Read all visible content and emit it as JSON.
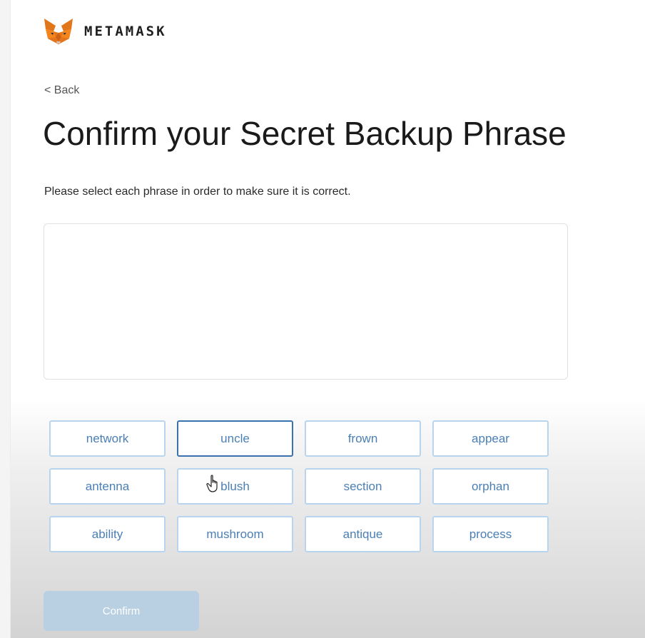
{
  "header": {
    "brand": "METAMASK",
    "logo_icon": "metamask-fox-icon"
  },
  "back": {
    "label": "< Back"
  },
  "title": "Confirm your Secret Backup Phrase",
  "instructions": "Please select each phrase in order to make sure it is correct.",
  "words": [
    {
      "label": "network",
      "selected": false
    },
    {
      "label": "uncle",
      "selected": true
    },
    {
      "label": "frown",
      "selected": false
    },
    {
      "label": "appear",
      "selected": false
    },
    {
      "label": "antenna",
      "selected": false
    },
    {
      "label": "blush",
      "selected": false
    },
    {
      "label": "section",
      "selected": false
    },
    {
      "label": "orphan",
      "selected": false
    },
    {
      "label": "ability",
      "selected": false
    },
    {
      "label": "mushroom",
      "selected": false
    },
    {
      "label": "antique",
      "selected": false
    },
    {
      "label": "process",
      "selected": false
    }
  ],
  "confirm": {
    "label": "Confirm",
    "disabled": true
  },
  "colors": {
    "accent": "#4a7fb5",
    "word_border": "#b7d5ee",
    "word_selected_border": "#3a72b0",
    "confirm_disabled": "#b9cfe2"
  }
}
